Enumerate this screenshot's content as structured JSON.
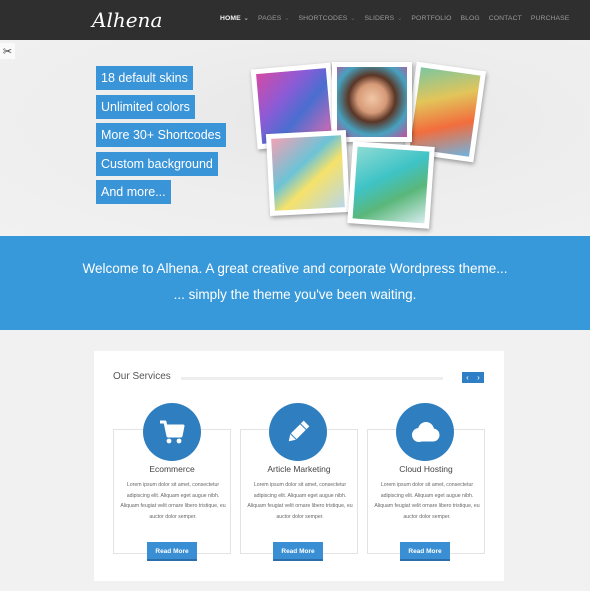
{
  "header": {
    "logo": "Alhena",
    "nav": [
      {
        "label": "HOME",
        "dropdown": true,
        "active": true
      },
      {
        "label": "PAGES",
        "dropdown": true
      },
      {
        "label": "SHORTCODES",
        "dropdown": true
      },
      {
        "label": "SLIDERS",
        "dropdown": true
      },
      {
        "label": "PORTFOLIO",
        "dropdown": false
      },
      {
        "label": "BLOG",
        "dropdown": false
      },
      {
        "label": "CONTACT",
        "dropdown": false
      },
      {
        "label": "PURCHASE",
        "dropdown": false
      }
    ],
    "dropdown_glyph": "⌄"
  },
  "hero": {
    "tools_icon": "✂",
    "features": [
      "18 default skins",
      "Unlimited colors",
      "More 30+ Shortcodes",
      "Custom background",
      "And more..."
    ]
  },
  "band": {
    "line1": "Welcome to Alhena. A great creative and corporate Wordpress theme...",
    "line2": "... simply the theme you've been waiting."
  },
  "services": {
    "title": "Our Services",
    "prev": "‹",
    "next": "›",
    "cards": [
      {
        "icon": "cart-icon",
        "title": "Ecommerce",
        "text": "Lorem ipsum dolor sit amet, consectetur adipiscing elit. Aliquam eget augue nibh. Aliquam feugiat velit ornare libero tristique, eu auctor dolor semper.",
        "button": "Read More"
      },
      {
        "icon": "pencil-icon",
        "title": "Article Marketing",
        "text": "Lorem ipsum dolor sit amet, consectetur adipiscing elit. Aliquam eget augue nibh. Aliquam feugiat velit ornare libero tristique, eu auctor dolor semper.",
        "button": "Read More"
      },
      {
        "icon": "cloud-icon",
        "title": "Cloud Hosting",
        "text": "Lorem ipsum dolor sit amet, consectetur adipiscing elit. Aliquam eget augue nibh. Aliquam feugiat velit ornare libero tristique, eu auctor dolor semper.",
        "button": "Read More"
      }
    ]
  },
  "colors": {
    "header_bg": "#2f2f2f",
    "accent": "#3899da",
    "icon_circle": "#2f7fc0"
  }
}
